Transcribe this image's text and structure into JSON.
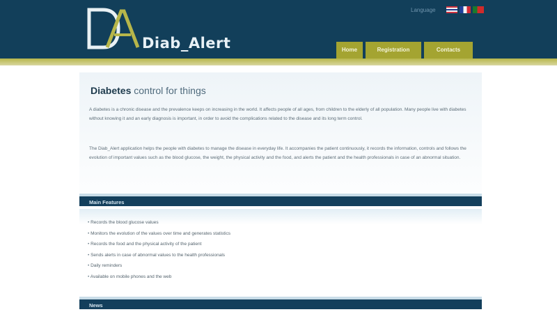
{
  "brand": {
    "name": "Diab_Alert",
    "logo_letters": "DA"
  },
  "header": {
    "lang_label": "Language",
    "flags": [
      "en-flag-icon",
      "fr-flag-icon",
      "pt-flag-icon"
    ]
  },
  "nav": {
    "items": [
      {
        "label": "Home"
      },
      {
        "label": "Registration"
      },
      {
        "label": "Contacts"
      }
    ]
  },
  "main": {
    "title_bold": "Diabetes",
    "title_rest": "control for things",
    "paragraphs": [
      "A diabetes is a chronic disease and the prevalence keeps on increasing in the world. It affects people of all ages, from children to the elderly of all population. Many people live with diabetes without knowing it and an early diagnosis is important, in order to avoid the complications related to the disease and its long term control.",
      "The Diab_Alert application helps the people with diabetes to manage the disease in everyday life. It accompanies the patient continuously, it records the information, controls and follows the evolution of important values such as the blood glucose, the weight, the physical activity and the food, and alerts the patient and the health professionals in case of an abnormal situation."
    ]
  },
  "features": {
    "heading": "Main Features",
    "items": [
      "Records the blood glucose values",
      "Monitors the evolution of the values over time and generates statistics",
      "Records the food and the physical activity of the patient",
      "Sends alerts in case of abnormal values to the health professionals",
      "Daily reminders",
      "Available on mobile phones and the web"
    ]
  },
  "next_section": {
    "heading": "News"
  },
  "colors": {
    "header_bg": "#123f5a",
    "accent_olive": "#a4a431",
    "section_bar": "#133f5c"
  }
}
